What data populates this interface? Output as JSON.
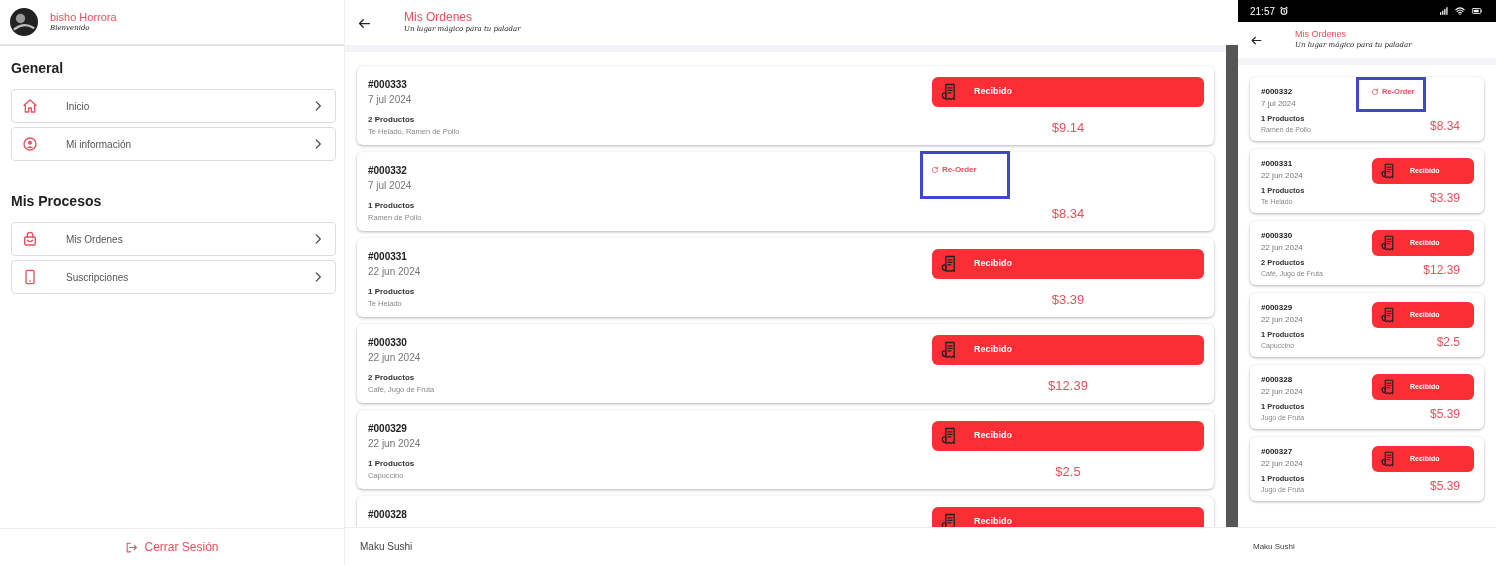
{
  "sidebar": {
    "user": {
      "name": "bisho Horrora",
      "greeting": "Bienvenido"
    },
    "sections": [
      {
        "title": "General",
        "items": [
          {
            "label": "Inicio",
            "kind": "home"
          },
          {
            "label": "Mi información",
            "kind": "user"
          }
        ]
      },
      {
        "title": "Mis Procesos",
        "items": [
          {
            "label": "Mis Ordenes",
            "kind": "bag"
          },
          {
            "label": "Suscripciones",
            "kind": "phone"
          }
        ]
      }
    ],
    "logout": "Cerrar Sesión"
  },
  "desktop": {
    "title": "Mis Ordenes",
    "subtitle": "Un lugar mágico para tu paladar",
    "orders": [
      {
        "number": "#000333",
        "date": "7 jul 2024",
        "count": "2 Productos",
        "items": "Te Helado, Ramen de Pollo",
        "kind": "recibido",
        "status_label": "Recibido",
        "total": "$9.14",
        "highlighted": false
      },
      {
        "number": "#000332",
        "date": "7 jul 2024",
        "count": "1 Productos",
        "items": "Ramen de Pollo",
        "kind": "reorder",
        "status_label": "Re-Order",
        "total": "$8.34",
        "highlighted": true
      },
      {
        "number": "#000331",
        "date": "22 jun 2024",
        "count": "1 Productos",
        "items": "Te Helado",
        "kind": "recibido",
        "status_label": "Recibido",
        "total": "$3.39",
        "highlighted": false
      },
      {
        "number": "#000330",
        "date": "22 jun 2024",
        "count": "2 Productos",
        "items": "Café, Jugo de Fruta",
        "kind": "recibido",
        "status_label": "Recibido",
        "total": "$12.39",
        "highlighted": false
      },
      {
        "number": "#000329",
        "date": "22 jun 2024",
        "count": "1 Productos",
        "items": "Capuccino",
        "kind": "recibido",
        "status_label": "Recibido",
        "total": "$2.5",
        "highlighted": false
      },
      {
        "number": "#000328",
        "kind": "recibido",
        "status_label": "Recibido",
        "highlighted": false
      }
    ],
    "footer": "Maku Sushi"
  },
  "phone": {
    "time": "21:57",
    "title": "Mis Ordenes",
    "subtitle": "Un lugar mágico para tu paladar",
    "orders": [
      {
        "number": "#000332",
        "date": "7 jul 2024",
        "count": "1 Productos",
        "items": "Ramen de Pollo",
        "kind": "reorder",
        "status_label": "Re-Order",
        "total": "$8.34",
        "highlighted": true
      },
      {
        "number": "#000331",
        "date": "22 jun 2024",
        "count": "1 Productos",
        "items": "Te Helado",
        "kind": "recibido",
        "status_label": "Recibido",
        "total": "$3.39",
        "highlighted": false
      },
      {
        "number": "#000330",
        "date": "22 jun 2024",
        "count": "2 Productos",
        "items": "Café, Jugo de Fruta",
        "kind": "recibido",
        "status_label": "Recibido",
        "total": "$12.39",
        "highlighted": false
      },
      {
        "number": "#000329",
        "date": "22 jun 2024",
        "count": "1 Productos",
        "items": "Capuccino",
        "kind": "recibido",
        "status_label": "Recibido",
        "total": "$2.5",
        "highlighted": false
      },
      {
        "number": "#000328",
        "date": "22 jun 2024",
        "count": "1 Productos",
        "items": "Jugo de Fruta",
        "kind": "recibido",
        "status_label": "Recibido",
        "total": "$5.39",
        "highlighted": false
      },
      {
        "number": "#000327",
        "date": "22 jun 2024",
        "count": "1 Productos",
        "items": "Jugo de Fruta",
        "kind": "recibido",
        "status_label": "Recibido",
        "total": "$5.39",
        "highlighted": false
      }
    ],
    "footer": "Maku Sushi"
  }
}
